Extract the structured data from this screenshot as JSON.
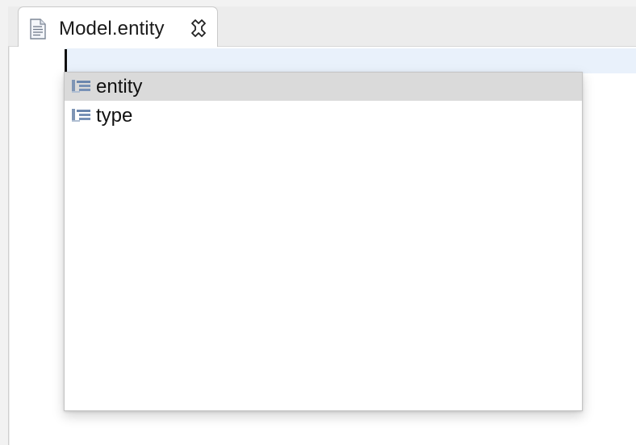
{
  "editor": {
    "tab": {
      "title": "Model.entity",
      "file_icon": "text-file-icon",
      "close_icon": "close-icon"
    },
    "current_line_color": "#e9f1fb"
  },
  "content_assist": {
    "selected_index": 0,
    "items": [
      {
        "label": "entity",
        "icon": "keyword-proposal-icon"
      },
      {
        "label": "type",
        "icon": "keyword-proposal-icon"
      }
    ]
  }
}
